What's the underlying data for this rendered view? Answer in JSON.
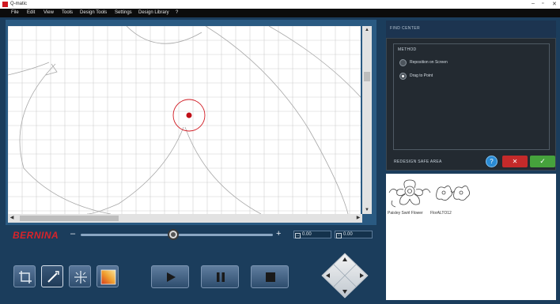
{
  "window": {
    "title": "Q-matic"
  },
  "window_controls": {
    "minimize": "–",
    "maximize": "▫",
    "close": "✕"
  },
  "menu": [
    "File",
    "Edit",
    "View",
    "Tools",
    "Design Tools",
    "Settings",
    "Design Library",
    "?"
  ],
  "brand": {
    "text": "BERNINA",
    "color": "#d8232a"
  },
  "zoom": {
    "minus": "–",
    "plus": "+",
    "level": 0.48
  },
  "coords": {
    "x": "0.00",
    "y": "0.00"
  },
  "right_panel": {
    "header": "FIND CENTER",
    "method_label": "METHOD",
    "options": [
      {
        "label": "Reposition on Screen",
        "selected": false
      },
      {
        "label": "Drag to Point",
        "selected": true
      }
    ],
    "safe_area_label": "REDESIGN SAFE AREA",
    "help_glyph": "?",
    "cancel_glyph": "✕",
    "ok_glyph": "✓"
  },
  "library": {
    "items": [
      {
        "name": "Paisley Swirl Flower"
      },
      {
        "name": "FlorALTO12"
      }
    ]
  },
  "tools": [
    "crop-icon",
    "needle-icon",
    "center-icon",
    "gradient-icon"
  ],
  "playback": [
    "play-icon",
    "pause-icon",
    "stop-icon"
  ],
  "colors": {
    "accent_red": "#d01820",
    "panel_blue": "#1b3d5c",
    "ok_green": "#46a23c",
    "help_blue": "#2a8bd4"
  }
}
